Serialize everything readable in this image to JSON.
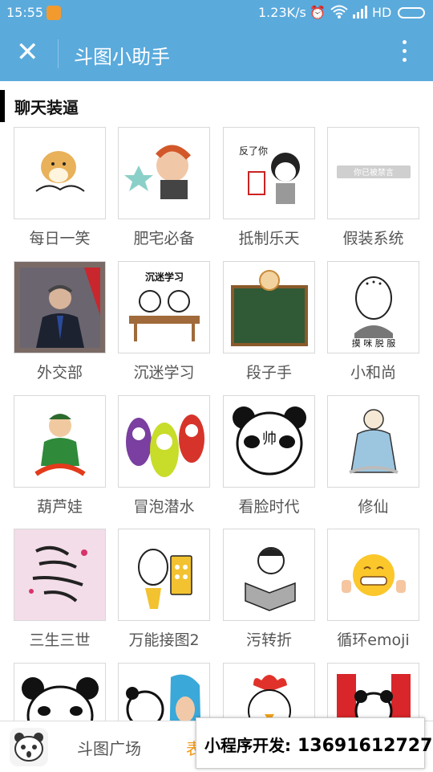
{
  "status_bar": {
    "time": "15:55",
    "speed": "1.23K/s",
    "network": "HD"
  },
  "navbar": {
    "close_icon": "close-icon",
    "title": "斗图小助手",
    "more_icon": "more-vertical-icon"
  },
  "section": {
    "title": "聊天装逼"
  },
  "tiles": [
    {
      "label": "每日一笑"
    },
    {
      "label": "肥宅必备"
    },
    {
      "label": "抵制乐天",
      "caption": "反了你"
    },
    {
      "label": "假装系统",
      "caption": "你已被禁言"
    },
    {
      "label": "外交部"
    },
    {
      "label": "沉迷学习",
      "caption": "沉迷学习"
    },
    {
      "label": "段子手"
    },
    {
      "label": "小和尚",
      "caption": "摸 咪 脱 服"
    },
    {
      "label": "葫芦娃"
    },
    {
      "label": "冒泡潜水"
    },
    {
      "label": "看脸时代",
      "caption": "帅"
    },
    {
      "label": "修仙"
    },
    {
      "label": "三生三世"
    },
    {
      "label": "万能接图2"
    },
    {
      "label": "污转折"
    },
    {
      "label": "循环emoji"
    },
    {
      "label": ""
    },
    {
      "label": ""
    },
    {
      "label": ""
    },
    {
      "label": ""
    }
  ],
  "bottom_nav": {
    "tab1": "斗图广场",
    "tab2": "表"
  },
  "promo": {
    "label": "小程序开发:",
    "phone": "13691612727"
  },
  "colors": {
    "header_bg": "#5aaadc",
    "active_tab": "#f19a1a"
  }
}
